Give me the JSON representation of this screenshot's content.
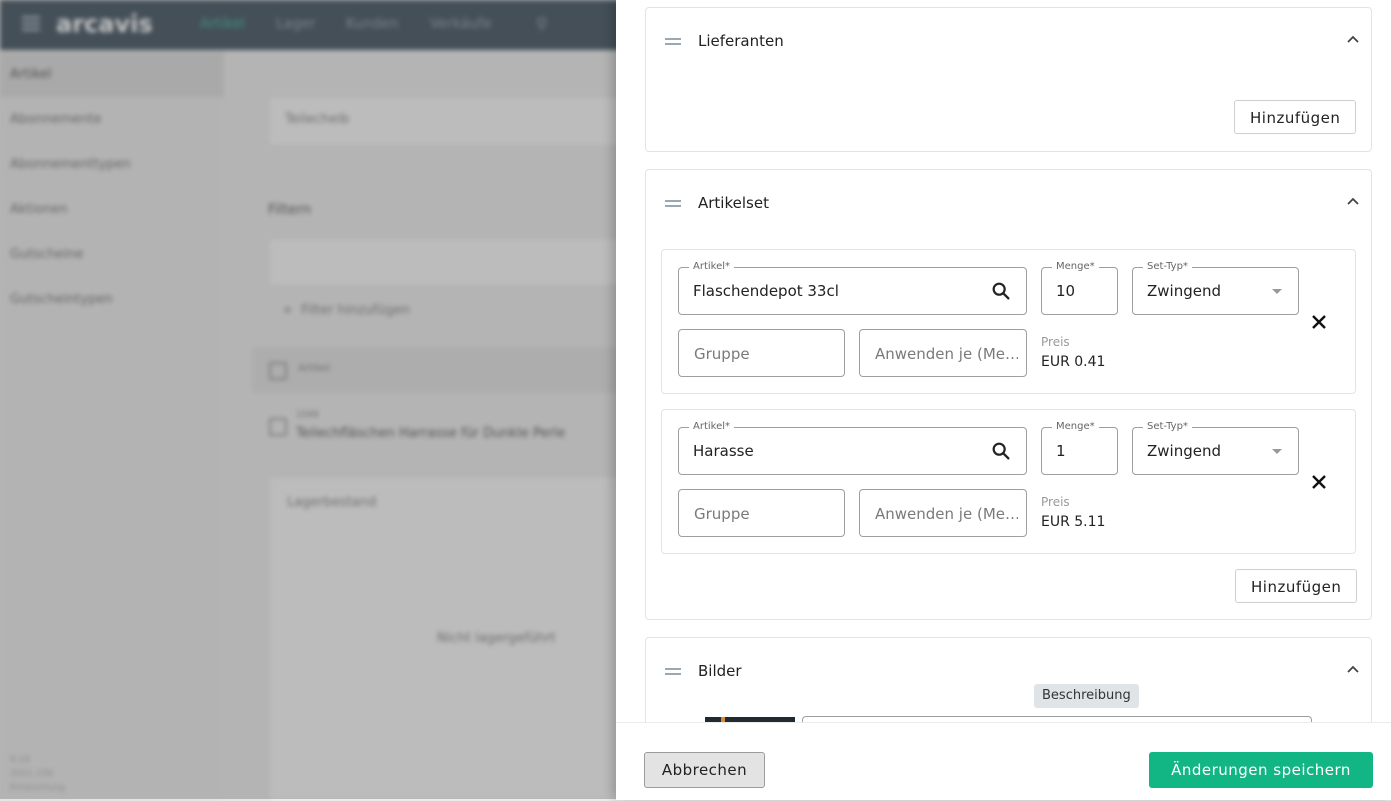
{
  "background": {
    "logo": "arcavis",
    "nav": [
      "Artikel",
      "Lager",
      "Kunden",
      "Verkäufe"
    ],
    "sidebar": [
      "Artikel",
      "Abonnemente",
      "Abonnementtypen",
      "Aktionen",
      "Gutscheine",
      "Gutscheintypen"
    ],
    "version_lines": [
      "9.18",
      "2021.156",
      "Entwicklung"
    ],
    "search_value": "Teilecheib",
    "filter_title": "Filtern",
    "add_filter": "Filter hinzufügen",
    "table_header": "Artikel",
    "row_id": "1049",
    "row_name": "Teilechfläschen Harrasse für Dunkle Perle",
    "stock_title": "Lagerbestand",
    "stock_text": "Nicht lagergeführt"
  },
  "suppliers": {
    "title": "Lieferanten",
    "add_label": "Hinzufügen"
  },
  "articleset": {
    "title": "Artikelset",
    "add_label": "Hinzufügen",
    "labels": {
      "article": "Artikel*",
      "quantity": "Menge*",
      "set_type": "Set-Typ*",
      "group_placeholder": "Gruppe",
      "apply_placeholder": "Anwenden je (Me…",
      "price": "Preis"
    },
    "rows": [
      {
        "article": "Flaschendepot 33cl",
        "quantity": "10",
        "set_type": "Zwingend",
        "price": "EUR 0.41"
      },
      {
        "article": "Harasse",
        "quantity": "1",
        "set_type": "Zwingend",
        "price": "EUR 5.11"
      }
    ]
  },
  "images": {
    "title": "Bilder",
    "description_badge": "Beschreibung"
  },
  "footer": {
    "cancel_label": "Abbrechen",
    "save_label": "Änderungen speichern"
  },
  "colors": {
    "primary": "#12b584",
    "topbar": "#1b2f3f"
  }
}
